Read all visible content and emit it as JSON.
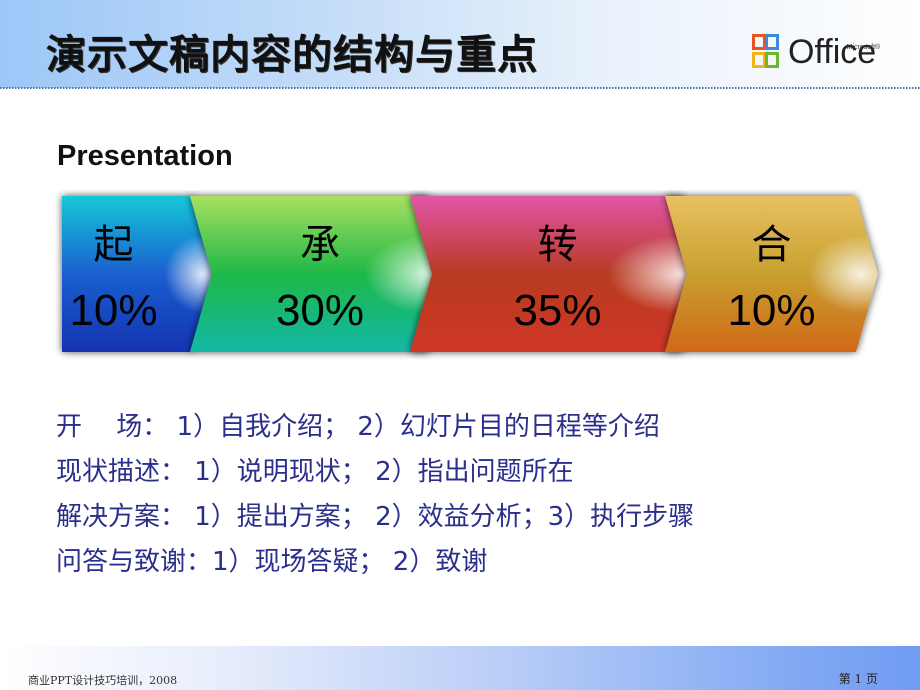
{
  "header": {
    "title": "演示文稿内容的结构与重点",
    "logo": {
      "brand": "Office",
      "superscript": "Microsoft®",
      "icon": "office-logo-icon"
    }
  },
  "subtitle": "Presentation",
  "stages": [
    {
      "char": "起",
      "percent": "10%",
      "value": 10,
      "colors": [
        "#18c8d8",
        "#1a5fd0",
        "#1533b0"
      ]
    },
    {
      "char": "承",
      "percent": "30%",
      "value": 30,
      "colors": [
        "#a8e060",
        "#1fb847",
        "#12b8a8"
      ]
    },
    {
      "char": "转",
      "percent": "35%",
      "value": 35,
      "colors": [
        "#e255a8",
        "#b83a20",
        "#d03828"
      ]
    },
    {
      "char": "合",
      "percent": "10%",
      "value": 10,
      "colors": [
        "#e8c060",
        "#c8a030",
        "#d06818"
      ]
    }
  ],
  "body": {
    "lines": [
      "开　 场： 1）自我介绍； 2）幻灯片目的日程等介绍",
      "现状描述： 1）说明现状； 2）指出问题所在",
      "解决方案： 1）提出方案； 2）效益分析；3）执行步骤",
      "问答与致谢：1）现场答疑； 2）致谢"
    ],
    "color": "#2b2f8c"
  },
  "footer": {
    "left": "商业PPT设计技巧培训，2008",
    "right": "第 1 页"
  }
}
